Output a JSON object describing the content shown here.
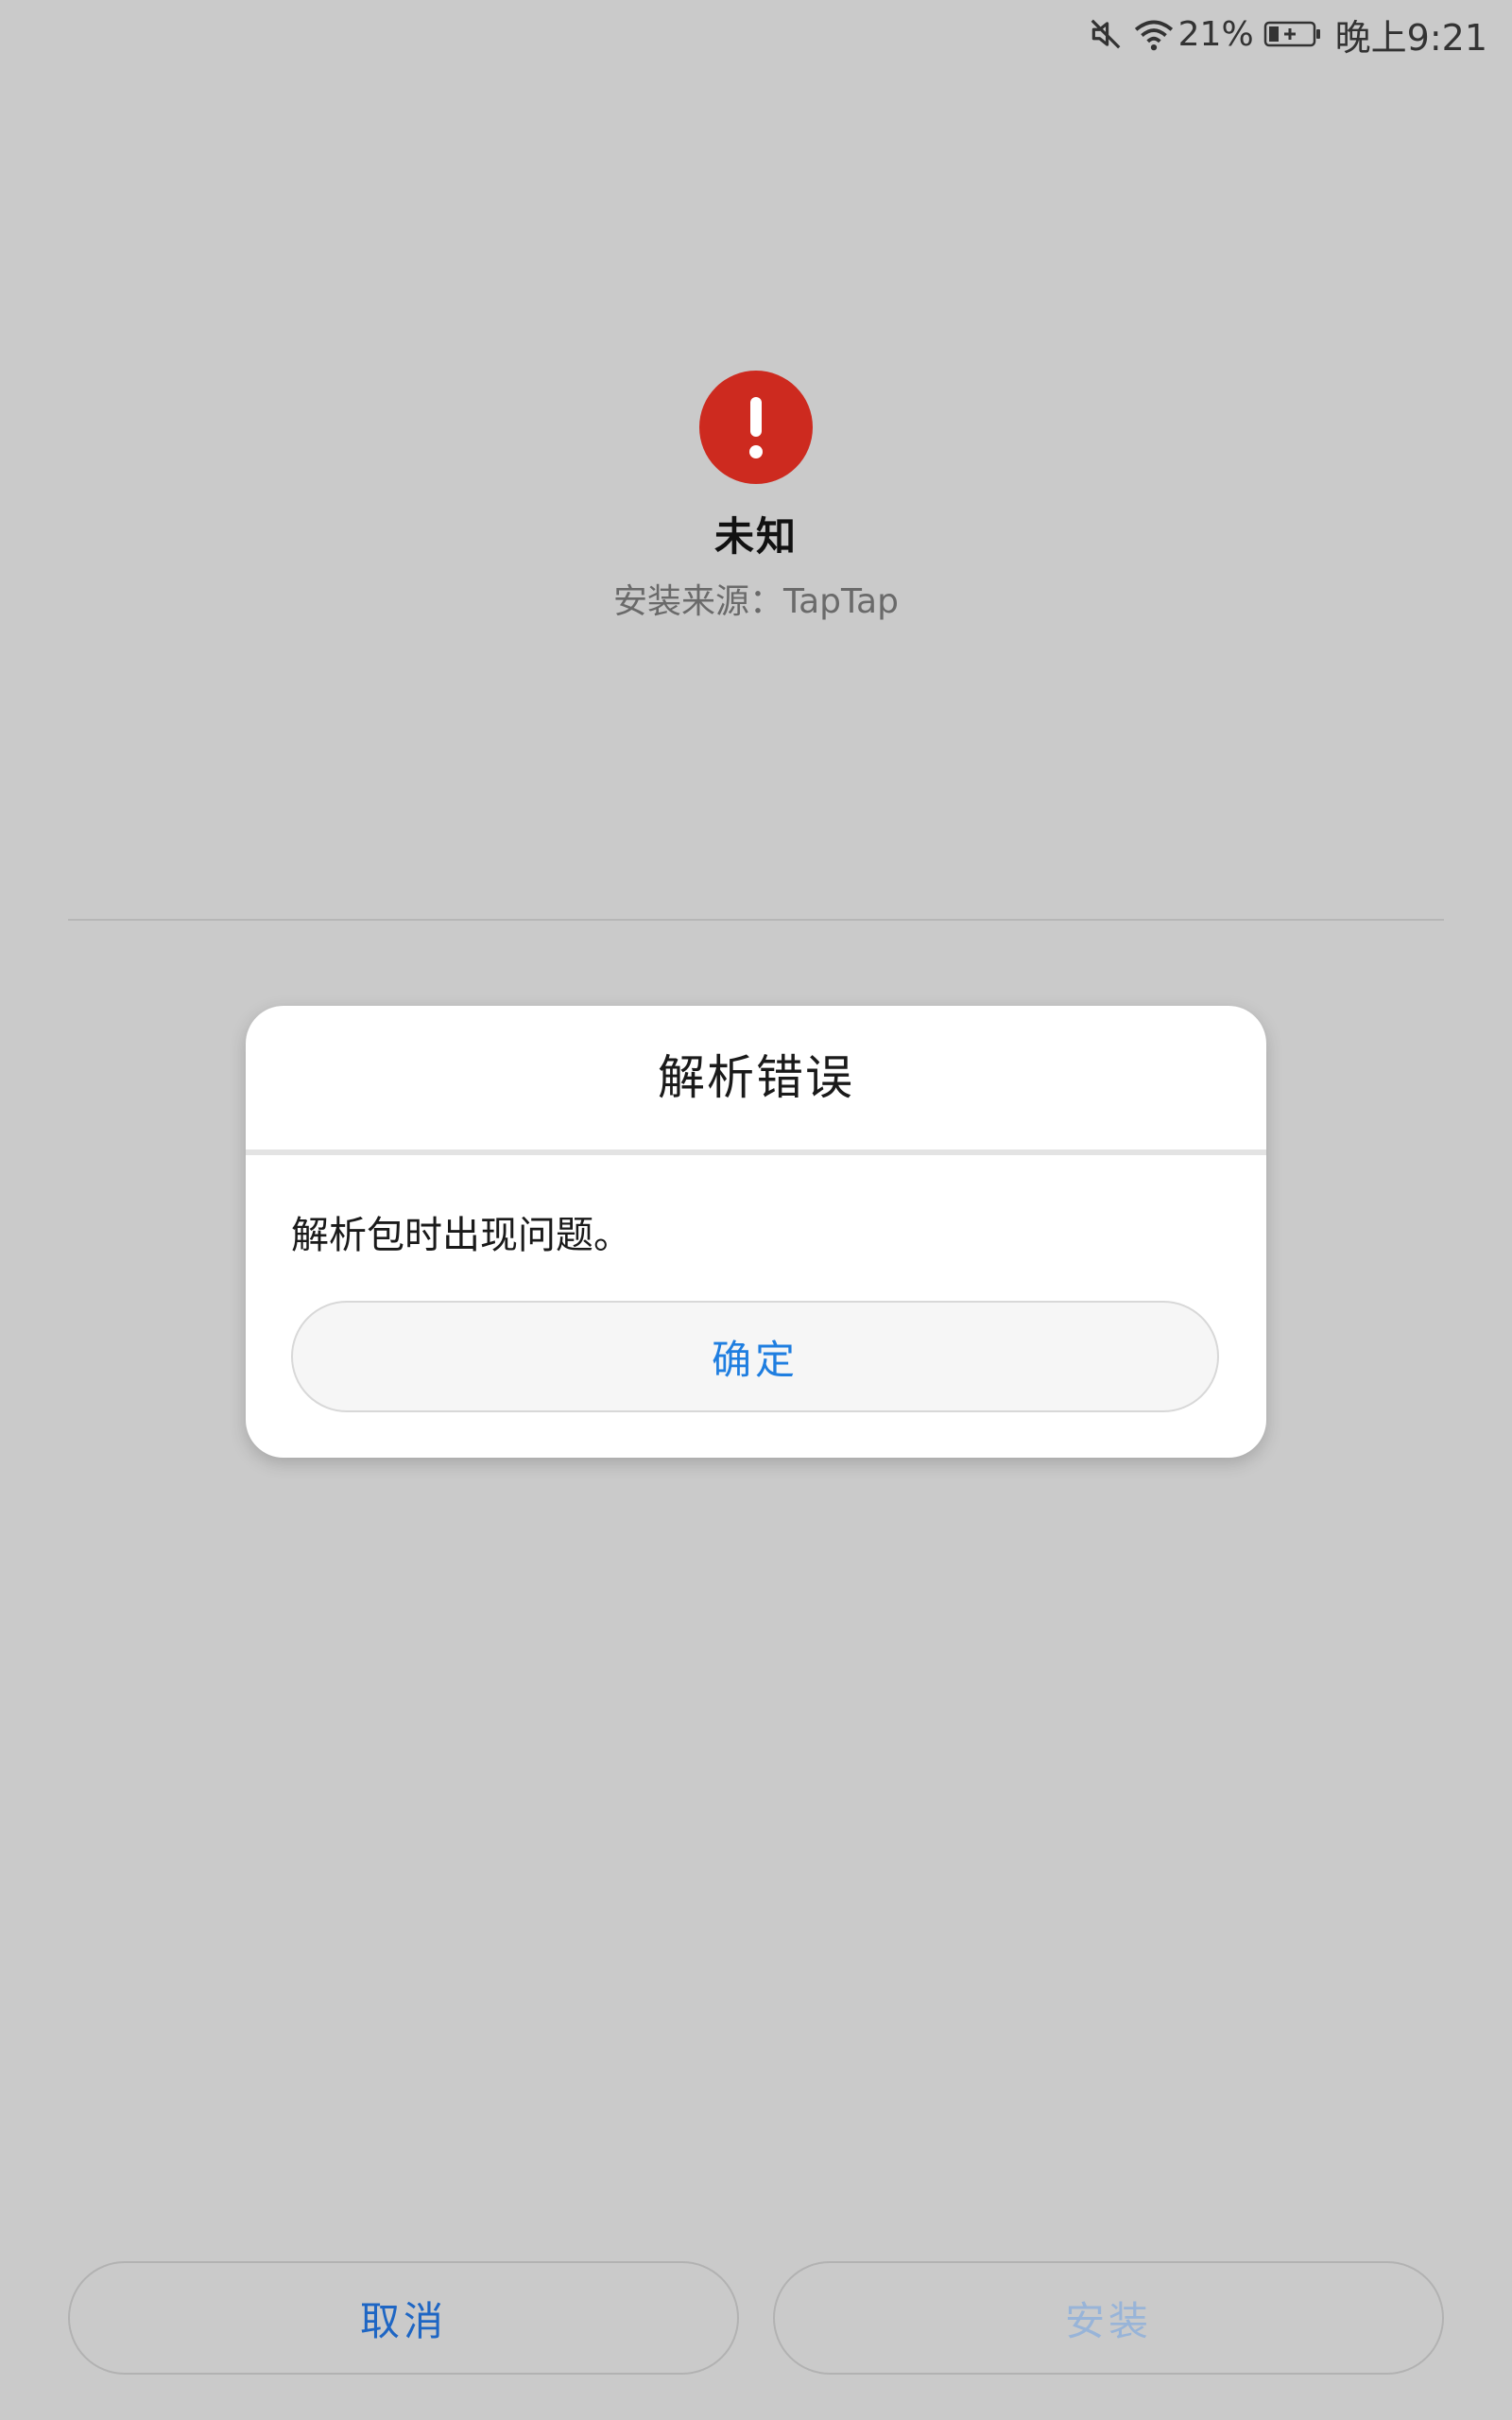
{
  "status_bar": {
    "mute_icon": "mute-icon",
    "wifi_icon": "wifi-icon",
    "battery_percent": "21%",
    "battery_icon": "battery-charging-icon",
    "time": "晚上9:21"
  },
  "app": {
    "icon": "warning-icon",
    "name": "未知",
    "install_source": "安装来源：TapTap"
  },
  "dialog": {
    "title": "解析错误",
    "message": "解析包时出现问题。",
    "confirm_label": "确定"
  },
  "bottom": {
    "cancel_label": "取消",
    "install_label": "安装"
  },
  "colors": {
    "background": "#cacaca",
    "warning_red": "#cd2a1f",
    "accent_blue": "#1f7ee0",
    "disabled_blue": "#98b4d8"
  }
}
